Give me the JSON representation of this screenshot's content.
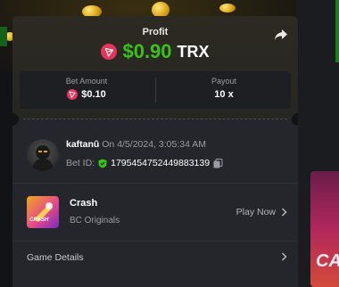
{
  "profit": {
    "title": "Profit",
    "amount": "$0.90",
    "currency": "TRX",
    "currency_icon": "tron-icon",
    "amount_color": "#3bc117"
  },
  "bet": {
    "amount_label": "Bet Amount",
    "amount_value": "$0.10",
    "payout_label": "Payout",
    "payout_value": "10 x"
  },
  "user": {
    "name": "kaftanû",
    "time": "On 4/5/2024, 3:05:34 AM",
    "bet_id_label": "Bet ID:",
    "bet_id": "1795454752449883139"
  },
  "game": {
    "name": "Crash",
    "provider": "BC Originals",
    "play_label": "Play Now",
    "thumb_text": "CRASH"
  },
  "details": {
    "label": "Game Details"
  },
  "promo": {
    "text": "CA"
  },
  "colors": {
    "accent_green": "#3bc117",
    "tron_red": "#e8345c",
    "panel": "#24262b"
  }
}
